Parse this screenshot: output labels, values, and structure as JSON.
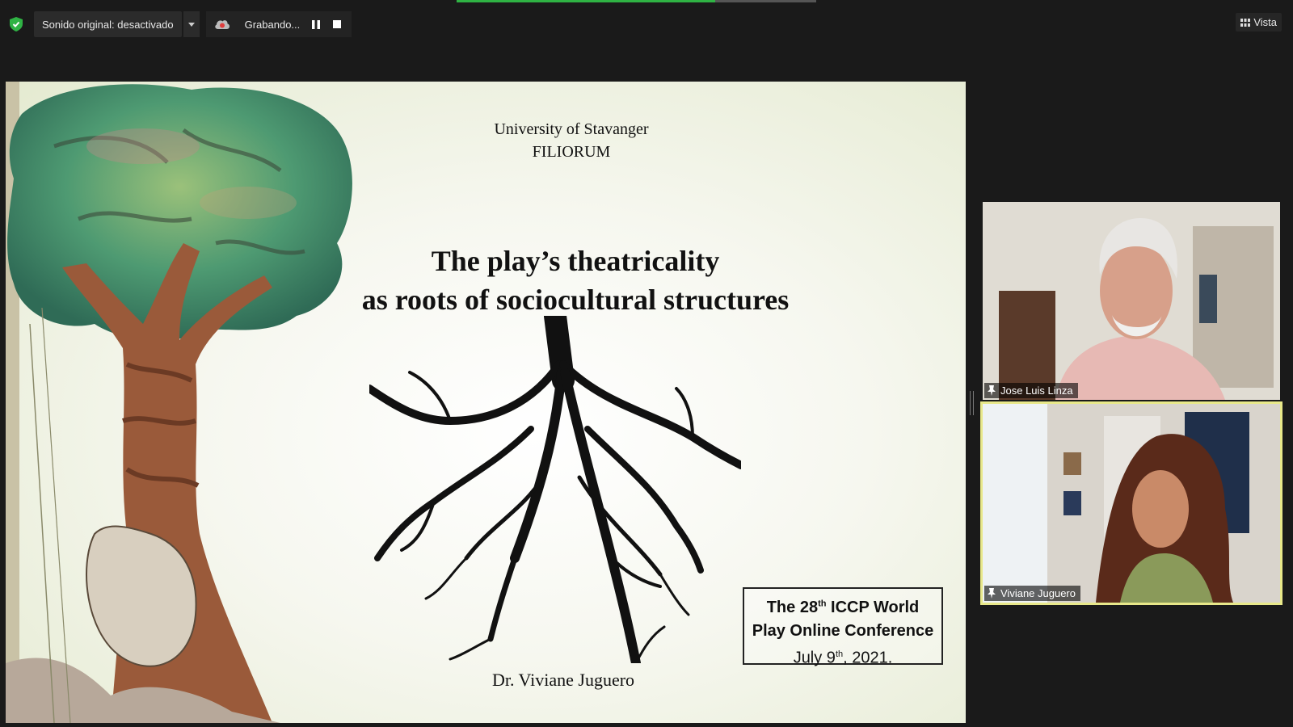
{
  "toolbar": {
    "audio_label": "Sonido original: desactivado",
    "recording_label": "Grabando...",
    "view_label": "Vista"
  },
  "slide": {
    "institution_line1": "University of Stavanger",
    "institution_line2": "FILIORUM",
    "title_line1": "The play’s theatricality",
    "title_line2": "as roots of sociocultural structures",
    "author": "Dr. Viviane Juguero",
    "conference": {
      "line1_pre": "The 28",
      "line1_sup": "th",
      "line1_post": " ICCP World",
      "line2": "Play Online Conference",
      "line3_pre": "July 9",
      "line3_sup": "th",
      "line3_post": ", 2021."
    }
  },
  "participants": [
    {
      "name": "Jose Luis Linza",
      "pinned": true,
      "active_speaker": false
    },
    {
      "name": "Viviane Juguero",
      "pinned": true,
      "active_speaker": true
    }
  ],
  "colors": {
    "background": "#1a1a1a",
    "shield": "#2fb344",
    "record": "#e03c3c",
    "speaker_border": "#e8e88a"
  }
}
